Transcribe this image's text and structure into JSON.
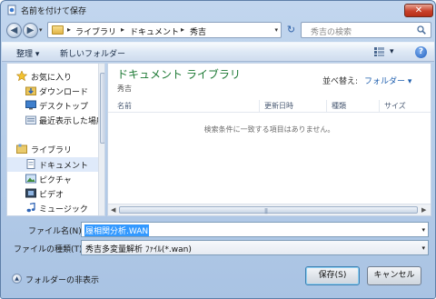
{
  "window": {
    "title": "名前を付けて保存",
    "close_glyph": "✕"
  },
  "address": {
    "breadcrumbs": [
      "ライブラリ",
      "ドキュメント",
      "秀吉"
    ],
    "separator": "▸",
    "dropdown_glyph": "▾"
  },
  "nav_glyphs": {
    "back": "◀",
    "forward": "▶",
    "history": "▾",
    "refresh": "↻"
  },
  "search": {
    "placeholder": "秀吉の検索"
  },
  "toolbar": {
    "organize": "整理 ▾",
    "new_folder": "新しいフォルダー",
    "view_dropdown": "▾",
    "help": "?"
  },
  "sidebar": {
    "favorites": {
      "label": "お気に入り",
      "items": [
        "ダウンロード",
        "デスクトップ",
        "最近表示した場所"
      ]
    },
    "libraries": {
      "label": "ライブラリ",
      "items": [
        "ドキュメント",
        "ピクチャ",
        "ビデオ",
        "ミュージック"
      ],
      "selected_index": 0
    }
  },
  "content": {
    "library_title": "ドキュメント ライブラリ",
    "library_subtitle": "秀吉",
    "arrange_label": "並べ替え:",
    "arrange_value": "フォルダー ▾",
    "columns": [
      "名前",
      "更新日時",
      "種類",
      "サイズ"
    ],
    "empty_message": "検索条件に一致する項目はありません。",
    "scroll_left": "◀",
    "scroll_right": "▶",
    "grip": "|||"
  },
  "form": {
    "filename_label": "ファイル名(N):",
    "filename_value": "履相関分析.WAN",
    "filetype_label": "ファイルの種類(T):",
    "filetype_value": "秀吉多変量解析 ﾌｧｲﾙ(*.wan)",
    "dropdown_glyph": "▾"
  },
  "footer": {
    "hide_folders": "フォルダーの非表示",
    "hide_glyph": "▲",
    "save": "保存(S)",
    "cancel": "キャンセル"
  },
  "colors": {
    "library_title": "#1e7a35",
    "arrange_value": "#1f5fae",
    "selection": "#3399ff",
    "close_button": "#c8412b"
  }
}
